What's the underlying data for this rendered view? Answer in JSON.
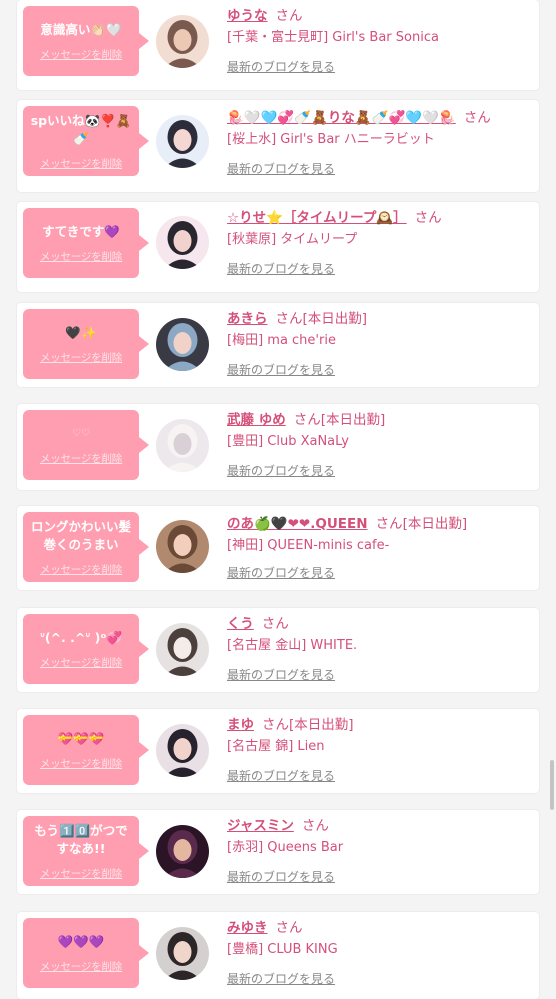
{
  "cards": [
    {
      "bubble": {
        "message": "意識高い👏🏻🤍",
        "delete_label": "メッセージを削除"
      },
      "avatar": "avatar-photo-1",
      "name": "ゆうな",
      "san": "さん",
      "working": "",
      "shop": "[千葉・富士見町] Girl's Bar Sonica",
      "blog_link": "最新のブログを見る"
    },
    {
      "bubble": {
        "message": "spいいね🐼❣️🧸🍼",
        "delete_label": "メッセージを削除"
      },
      "avatar": "avatar-photo-2",
      "name": "🪼🤍🩵💞🍼🧸りな🧸🍼💞🩵🤍🪼",
      "san": "さん",
      "working": "",
      "shop": "[桜上水] Girl's Bar ハニーラビット",
      "blog_link": "最新のブログを見る"
    },
    {
      "bubble": {
        "message": "すてきです💜",
        "delete_label": "メッセージを削除"
      },
      "avatar": "avatar-photo-3",
      "name": "☆りせ⭐️［タイムリープ🕰️］",
      "san": "さん",
      "working": "",
      "shop": "[秋葉原] タイムリープ",
      "blog_link": "最新のブログを見る"
    },
    {
      "bubble": {
        "message": "🖤✨",
        "delete_label": "メッセージを削除"
      },
      "avatar": "avatar-photo-4",
      "name": "あきら",
      "san": "さん",
      "working": "[本日出勤]",
      "shop": "[梅田] ma che'rie",
      "blog_link": "最新のブログを見る"
    },
    {
      "bubble": {
        "message": "♡♡",
        "delete_label": "メッセージを削除"
      },
      "avatar": "avatar-photo-5",
      "name": "武藤 ゆめ",
      "san": "さん",
      "working": "[本日出勤]",
      "shop": "[豊田] Club XaNaLy",
      "blog_link": "最新のブログを見る"
    },
    {
      "bubble": {
        "message": "ロングかわいい髪巻くのうまい",
        "delete_label": "メッセージを削除"
      },
      "avatar": "avatar-photo-6",
      "name": "のあ🍏🖤‪‪❤︎‬‪‪❤︎‬.QUEEN",
      "san": "さん",
      "working": "[本日出勤]",
      "shop": "[神田] QUEEN-minis cafe-",
      "blog_link": "最新のブログを見る"
    },
    {
      "bubble": {
        "message": "ᐡ(^. .^ᐡ )ᵒ💞",
        "delete_label": "メッセージを削除"
      },
      "avatar": "avatar-photo-7",
      "name": "くう",
      "san": "さん",
      "working": "",
      "shop": "[名古屋 金山] WHITE.",
      "blog_link": "最新のブログを見る"
    },
    {
      "bubble": {
        "message": "💝💝💝",
        "delete_label": "メッセージを削除"
      },
      "avatar": "avatar-photo-8",
      "name": "まゆ",
      "san": "さん",
      "working": "[本日出勤]",
      "shop": "[名古屋 錦] Lien",
      "blog_link": "最新のブログを見る"
    },
    {
      "bubble": {
        "message": "もう1️⃣0️⃣がつですなあ!!",
        "delete_label": "メッセージを削除"
      },
      "avatar": "avatar-photo-9",
      "name": "ジャスミン",
      "san": "さん",
      "working": "",
      "shop": "[赤羽] Queens Bar",
      "blog_link": "最新のブログを見る"
    },
    {
      "bubble": {
        "message": "💜💜💜",
        "delete_label": "メッセージを削除"
      },
      "avatar": "avatar-photo-10",
      "name": "みゆき",
      "san": "さん",
      "working": "",
      "shop": "[豊橋] CLUB KING",
      "blog_link": "最新のブログを見る"
    }
  ],
  "colors": {
    "bubble": "#ff9eb0",
    "name": "#d4507a",
    "link": "#888888",
    "background": "#f4f4f4"
  }
}
